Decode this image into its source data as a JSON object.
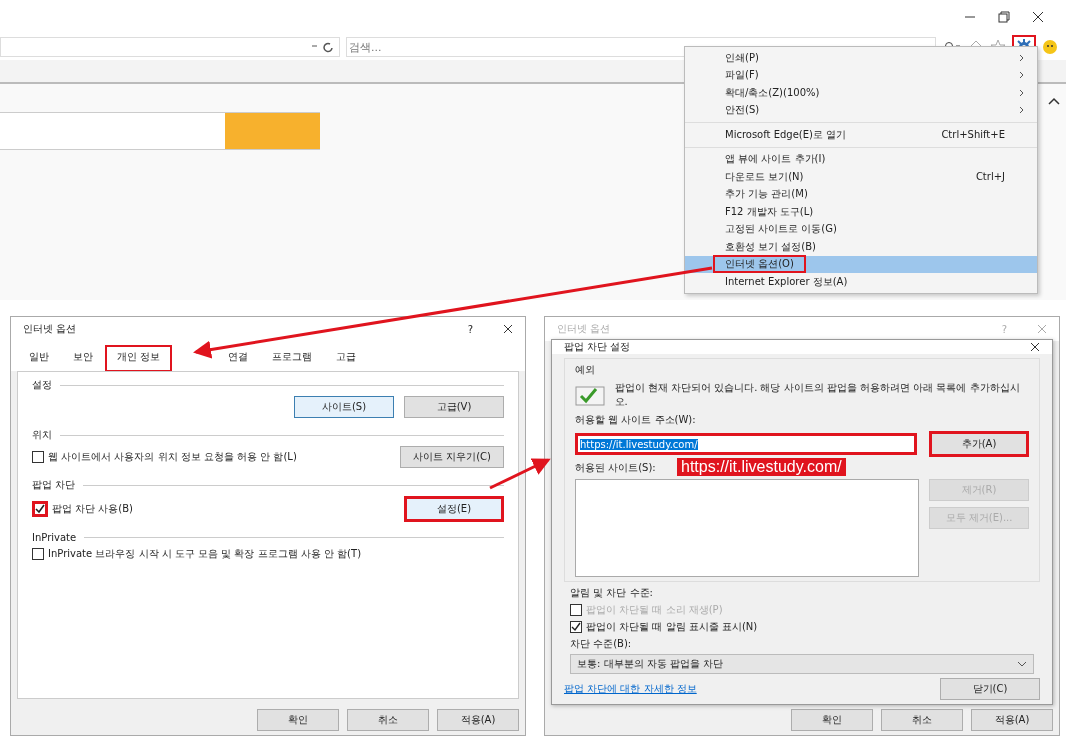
{
  "browser": {
    "search": {
      "placeholder": "검색..."
    },
    "gear_highlighted": true,
    "menu": {
      "groups": [
        [
          {
            "label": "인쇄(P)",
            "submenu": true,
            "selected": false,
            "highlighted": false
          },
          {
            "label": "파일(F)",
            "submenu": true,
            "selected": false,
            "highlighted": false
          },
          {
            "label": "확대/축소(Z)(100%)",
            "submenu": true,
            "selected": false,
            "highlighted": false
          },
          {
            "label": "안전(S)",
            "submenu": true,
            "selected": false,
            "highlighted": false
          }
        ],
        [
          {
            "label": "Microsoft Edge(E)로 열기",
            "shortcut": "Ctrl+Shift+E",
            "submenu": false,
            "selected": false,
            "highlighted": false
          }
        ],
        [
          {
            "label": "앱 뷰에 사이트 추가(I)",
            "submenu": false,
            "selected": false,
            "highlighted": false
          },
          {
            "label": "다운로드 보기(N)",
            "shortcut": "Ctrl+J",
            "submenu": false,
            "selected": false,
            "highlighted": false
          },
          {
            "label": "추가 기능 관리(M)",
            "submenu": false,
            "selected": false,
            "highlighted": false
          },
          {
            "label": "F12 개발자 도구(L)",
            "submenu": false,
            "selected": false,
            "highlighted": false
          },
          {
            "label": "고정된 사이트로 이동(G)",
            "submenu": false,
            "selected": false,
            "highlighted": false
          },
          {
            "label": "호환성 보기 설정(B)",
            "submenu": false,
            "selected": false,
            "highlighted": false
          },
          {
            "label": "인터넷 옵션(O)",
            "submenu": false,
            "selected": true,
            "highlighted": true
          },
          {
            "label": "Internet Explorer 정보(A)",
            "submenu": false,
            "selected": false,
            "highlighted": false
          }
        ]
      ]
    }
  },
  "options_dialog": {
    "title": "인터넷 옵션",
    "help": "?",
    "tabs": [
      {
        "label": "일반",
        "selected": false,
        "highlighted": false
      },
      {
        "label": "보안",
        "selected": false,
        "highlighted": false
      },
      {
        "label": "개인 정보",
        "selected": true,
        "highlighted": true
      },
      {
        "label": "연결",
        "selected": false,
        "highlighted": false
      },
      {
        "label": "프로그램",
        "selected": false,
        "highlighted": false
      },
      {
        "label": "고급",
        "selected": false,
        "highlighted": false
      }
    ],
    "sections": [
      {
        "title": "설정",
        "buttons": [
          {
            "label": "사이트(S)",
            "focused": true,
            "highlighted": false
          },
          {
            "label": "고급(V)",
            "focused": false,
            "highlighted": false
          }
        ]
      },
      {
        "title": "위치",
        "checkbox": {
          "label": "웹 사이트에서 사용자의 위치 정보 요청을 허용 안 함(L)",
          "checked": false,
          "highlighted": false
        },
        "buttons": [
          {
            "label": "사이트 지우기(C)",
            "focused": false,
            "highlighted": false
          }
        ]
      },
      {
        "title": "팝업 차단",
        "checkbox": {
          "label": "팝업 차단 사용(B)",
          "checked": true,
          "highlighted": true
        },
        "buttons": [
          {
            "label": "설정(E)",
            "focused": true,
            "highlighted": true
          }
        ]
      },
      {
        "title": "InPrivate",
        "checkbox": {
          "label": "InPrivate 브라우징 시작 시 도구 모음 및 확장 프로그램 사용 안 함(T)",
          "checked": false,
          "highlighted": false
        }
      }
    ],
    "footer": [
      "확인",
      "취소",
      "적용(A)"
    ]
  },
  "popup_dialog": {
    "back_title": "인터넷 옵션",
    "back_help": "?",
    "title": "팝업 차단 설정",
    "group": "예외",
    "info": "팝업이 현재 차단되어 있습니다. 해당 사이트의 팝업을 허용하려면 아래 목록에 추가하십시오.",
    "address_label": "허용할 웹 사이트 주소(W):",
    "address_value": "https://it.livestudy.com/",
    "address_highlighted": true,
    "add_button": {
      "label": "추가(A)",
      "highlighted": true
    },
    "callout": "https://it.livestudy.com/",
    "allowed_label": "허용된 사이트(S):",
    "list_buttons": [
      {
        "label": "제거(R)",
        "disabled": true
      },
      {
        "label": "모두 제거(E)...",
        "disabled": true
      }
    ],
    "notify_label": "알림 및 차단 수준:",
    "checkboxes": [
      {
        "label": "팝업이 차단될 때 소리 재생(P)",
        "checked": false,
        "disabled": true
      },
      {
        "label": "팝업이 차단될 때 알림 표시줄 표시(N)",
        "checked": true,
        "disabled": false
      }
    ],
    "level_label": "차단 수준(B):",
    "level_value": "보통: 대부분의 자동 팝업을 차단",
    "link": "팝업 차단에 대한 자세한 정보",
    "close_button": "닫기(C)",
    "back_footer": [
      "확인",
      "취소",
      "적용(A)"
    ]
  }
}
